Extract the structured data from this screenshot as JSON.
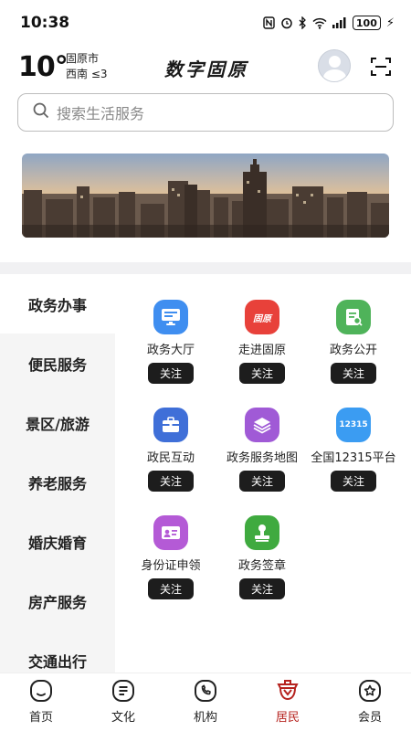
{
  "status_bar": {
    "time": "10:38",
    "battery": "100"
  },
  "header": {
    "temperature": "10°",
    "city": "固原市",
    "wind": "西南  ≤3",
    "app_title": "数字固原"
  },
  "search": {
    "placeholder": "搜索生活服务"
  },
  "categories": [
    {
      "label": "政务办事",
      "active": true
    },
    {
      "label": "便民服务",
      "active": false
    },
    {
      "label": "景区/旅游",
      "active": false
    },
    {
      "label": "养老服务",
      "active": false
    },
    {
      "label": "婚庆婚育",
      "active": false
    },
    {
      "label": "房产服务",
      "active": false
    },
    {
      "label": "交通出行",
      "active": false
    }
  ],
  "services": [
    {
      "label": "政务大厅",
      "icon": "monitor-icon",
      "color": "#3f8ef0",
      "follow": "关注"
    },
    {
      "label": "走进固原",
      "icon": "guyuan-logo-icon",
      "color": "#e8413a",
      "icon_text": "固原",
      "follow": "关注"
    },
    {
      "label": "政务公开",
      "icon": "document-search-icon",
      "color": "#4fb35a",
      "follow": "关注"
    },
    {
      "label": "政民互动",
      "icon": "briefcase-icon",
      "color": "#3f6fd8",
      "follow": "关注"
    },
    {
      "label": "政务服务地图",
      "icon": "layers-icon",
      "color": "#a05ad6",
      "follow": "关注"
    },
    {
      "label": "全国12315平台",
      "icon": "hotline-12315-icon",
      "color": "#3b9cf2",
      "icon_text": "12315",
      "follow": "关注"
    },
    {
      "label": "身份证申领",
      "icon": "id-card-icon",
      "color": "#b45ad6",
      "follow": "关注"
    },
    {
      "label": "政务签章",
      "icon": "stamp-icon",
      "color": "#3faa3f",
      "follow": "关注"
    }
  ],
  "tabs": [
    {
      "label": "首页",
      "icon": "home-icon",
      "active": false
    },
    {
      "label": "文化",
      "icon": "culture-icon",
      "active": false
    },
    {
      "label": "机构",
      "icon": "phone-icon",
      "active": false
    },
    {
      "label": "居民",
      "icon": "residents-icon",
      "active": true
    },
    {
      "label": "会员",
      "icon": "member-star-icon",
      "active": false
    }
  ],
  "colors": {
    "accent": "#b6231f",
    "follow_button": "#1d1d1d",
    "sidebar_bg": "#f5f5f5"
  }
}
